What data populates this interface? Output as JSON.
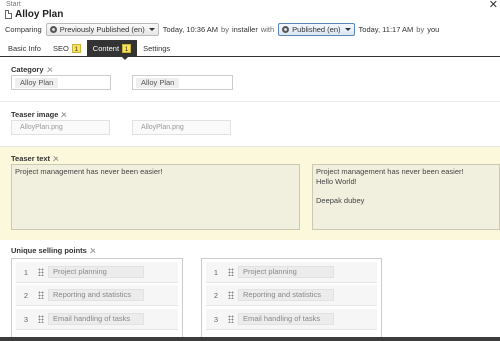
{
  "header": {
    "breadcrumb": "Start",
    "title": "Alloy Plan",
    "close_glyph": "✕"
  },
  "compare": {
    "label": "Comparing",
    "left_version": "Previously Published (en)",
    "left_time": "Today, 10:36 AM",
    "by1": "by",
    "left_author": "installer",
    "with": "with",
    "right_version": "Published (en)",
    "right_time": "Today, 11:17 AM",
    "by2": "by",
    "right_author": "you"
  },
  "tabs": [
    {
      "label": "Basic Info",
      "badge": ""
    },
    {
      "label": "SEO",
      "badge": "1"
    },
    {
      "label": "Content",
      "badge": "1",
      "active": true
    },
    {
      "label": "Settings",
      "badge": ""
    }
  ],
  "category": {
    "label": "Category",
    "left_value": "Alloy Plan",
    "right_value": "Alloy Plan"
  },
  "teaser_image": {
    "label": "Teaser image",
    "left_value": "AlloyPlan.png",
    "right_value": "AlloyPlan.png"
  },
  "teaser_text": {
    "label": "Teaser text",
    "left_value": "Project management has never been easier!",
    "right_value": "Project management has never been easier!\nHello World!\n\nDeepak dubey"
  },
  "usp": {
    "label": "Unique selling points",
    "left_items": [
      {
        "num": "1",
        "text": "Project planning"
      },
      {
        "num": "2",
        "text": "Reporting and statistics"
      },
      {
        "num": "3",
        "text": "Email handling of tasks"
      }
    ],
    "right_items": [
      {
        "num": "1",
        "text": "Project planning"
      },
      {
        "num": "2",
        "text": "Reporting and statistics"
      },
      {
        "num": "3",
        "text": "Email handling of tasks"
      }
    ]
  },
  "colors": {
    "accent_dark": "#333333",
    "badge_yellow": "#f9e35a",
    "highlight_bg": "#fcf8dc"
  }
}
